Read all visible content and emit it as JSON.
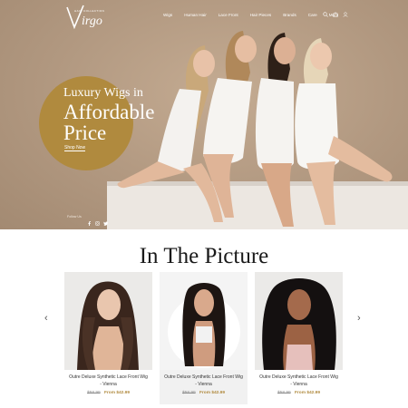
{
  "brand": {
    "logo_text": "Virgo",
    "logo_tagline": "HAIR COLLECTION"
  },
  "nav": {
    "items": [
      "Wigs",
      "Human Hair",
      "Lace Front",
      "Hair Pieces",
      "Brands",
      "Care",
      "More"
    ],
    "icons": [
      "search-icon",
      "bag-icon",
      "user-icon"
    ]
  },
  "hero": {
    "line1": "Luxury Wigs in",
    "line2": "Affordable",
    "line3": "Price",
    "cta": "Shop Now",
    "social_label": "Follow Us",
    "social_icons": [
      "facebook-icon",
      "instagram-icon",
      "twitter-icon"
    ],
    "colors": {
      "accent": "#b08a3e",
      "background": "#b39a82"
    }
  },
  "section": {
    "title": "In The Picture"
  },
  "products": [
    {
      "name": "Outre Deluxe Synthetic Lace Front Wig - Vienna",
      "old_price": "$58.99",
      "new_price": "From $42.99"
    },
    {
      "name": "Outre Deluxe Synthetic Lace Front Wig - Vienna",
      "old_price": "$58.99",
      "new_price": "From $42.99"
    },
    {
      "name": "Outre Deluxe Synthetic Lace Front Wig - Vienna",
      "old_price": "$58.99",
      "new_price": "From $42.99"
    }
  ],
  "carousel": {
    "prev": "‹",
    "next": "›"
  }
}
